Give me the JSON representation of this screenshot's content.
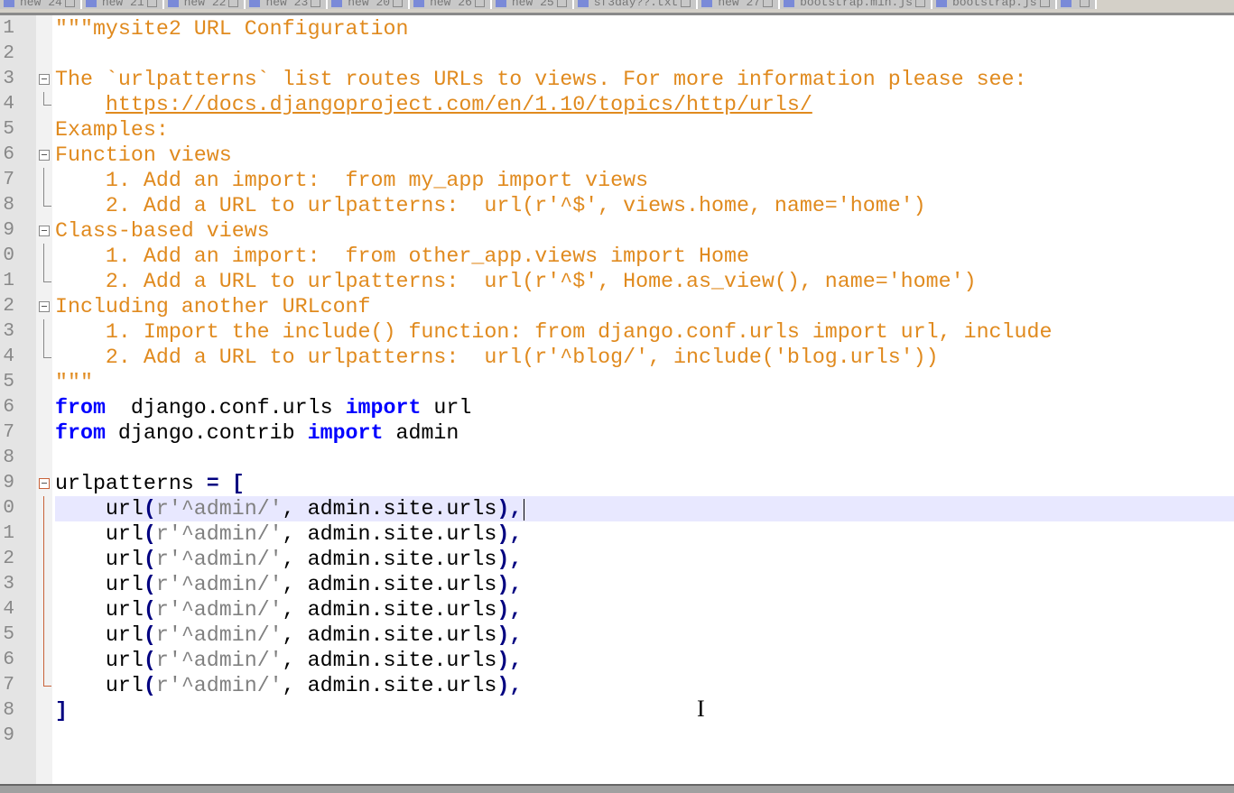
{
  "tabs": [
    "new 24",
    "new 21",
    "new 22",
    "new 23",
    "new 20",
    "new 26",
    "new 25",
    "sf3day??.txt",
    "new 27",
    "bootstrap.min.js",
    "bootstrap.js",
    ""
  ],
  "current_line": 20,
  "lines": [
    {
      "n": "1",
      "t": [
        [
          "doc",
          "\"\"\"mysite2 URL Configuration"
        ]
      ]
    },
    {
      "n": "2",
      "t": []
    },
    {
      "n": "3",
      "f": "box",
      "t": [
        [
          "doc",
          "The `urlpatterns` list routes URLs to views. For more information please see:"
        ]
      ]
    },
    {
      "n": "4",
      "f": "end",
      "t": [
        [
          "doc",
          "    "
        ],
        [
          "link",
          "https://docs.djangoproject.com/en/1.10/topics/http/urls/"
        ]
      ]
    },
    {
      "n": "5",
      "t": [
        [
          "doc",
          "Examples:"
        ]
      ]
    },
    {
      "n": "6",
      "f": "box",
      "t": [
        [
          "doc",
          "Function views"
        ]
      ]
    },
    {
      "n": "7",
      "f": "line",
      "t": [
        [
          "doc",
          "    1. Add an import:  from my_app import views"
        ]
      ]
    },
    {
      "n": "8",
      "f": "end",
      "t": [
        [
          "doc",
          "    2. Add a URL to urlpatterns:  url(r'^$', views.home, name='home')"
        ]
      ]
    },
    {
      "n": "9",
      "f": "box",
      "t": [
        [
          "doc",
          "Class-based views"
        ]
      ]
    },
    {
      "n": "0",
      "f": "line",
      "t": [
        [
          "doc",
          "    1. Add an import:  from other_app.views import Home"
        ]
      ]
    },
    {
      "n": "1",
      "f": "end",
      "t": [
        [
          "doc",
          "    2. Add a URL to urlpatterns:  url(r'^$', Home.as_view(), name='home')"
        ]
      ]
    },
    {
      "n": "2",
      "f": "box",
      "t": [
        [
          "doc",
          "Including another URLconf"
        ]
      ]
    },
    {
      "n": "3",
      "f": "line",
      "t": [
        [
          "doc",
          "    1. Import the include() function: from django.conf.urls import url, include"
        ]
      ]
    },
    {
      "n": "4",
      "f": "end",
      "t": [
        [
          "doc",
          "    2. Add a URL to urlpatterns:  url(r'^blog/', include('blog.urls'))"
        ]
      ]
    },
    {
      "n": "5",
      "t": [
        [
          "doc",
          "\"\"\""
        ]
      ]
    },
    {
      "n": "6",
      "t": [
        [
          "kw",
          "from"
        ],
        [
          "",
          "  django.conf.urls "
        ],
        [
          "kw",
          "import"
        ],
        [
          "",
          " url"
        ]
      ]
    },
    {
      "n": "7",
      "t": [
        [
          "kw",
          "from"
        ],
        [
          "",
          " django.contrib "
        ],
        [
          "kw",
          "import"
        ],
        [
          "",
          " admin"
        ]
      ]
    },
    {
      "n": "8",
      "t": []
    },
    {
      "n": "9",
      "f": "boxred",
      "t": [
        [
          "",
          "urlpatterns "
        ],
        [
          "op",
          "="
        ],
        [
          "",
          " "
        ],
        [
          "op",
          "["
        ]
      ]
    },
    {
      "n": "0",
      "f": "linered",
      "t": [
        [
          "",
          "    url"
        ],
        [
          "op",
          "("
        ],
        [
          "str",
          "r'^admin/'"
        ],
        [
          "",
          ", admin.site.urls"
        ],
        [
          "op",
          "),"
        ]
      ]
    },
    {
      "n": "1",
      "f": "linered",
      "t": [
        [
          "",
          "    url"
        ],
        [
          "op",
          "("
        ],
        [
          "str",
          "r'^admin/'"
        ],
        [
          "",
          ", admin.site.urls"
        ],
        [
          "op",
          "),"
        ]
      ]
    },
    {
      "n": "2",
      "f": "linered",
      "t": [
        [
          "",
          "    url"
        ],
        [
          "op",
          "("
        ],
        [
          "str",
          "r'^admin/'"
        ],
        [
          "",
          ", admin.site.urls"
        ],
        [
          "op",
          "),"
        ]
      ]
    },
    {
      "n": "3",
      "f": "linered",
      "t": [
        [
          "",
          "    url"
        ],
        [
          "op",
          "("
        ],
        [
          "str",
          "r'^admin/'"
        ],
        [
          "",
          ", admin.site.urls"
        ],
        [
          "op",
          "),"
        ]
      ]
    },
    {
      "n": "4",
      "f": "linered",
      "t": [
        [
          "",
          "    url"
        ],
        [
          "op",
          "("
        ],
        [
          "str",
          "r'^admin/'"
        ],
        [
          "",
          ", admin.site.urls"
        ],
        [
          "op",
          "),"
        ]
      ]
    },
    {
      "n": "5",
      "f": "linered",
      "t": [
        [
          "",
          "    url"
        ],
        [
          "op",
          "("
        ],
        [
          "str",
          "r'^admin/'"
        ],
        [
          "",
          ", admin.site.urls"
        ],
        [
          "op",
          "),"
        ]
      ]
    },
    {
      "n": "6",
      "f": "linered",
      "t": [
        [
          "",
          "    url"
        ],
        [
          "op",
          "("
        ],
        [
          "str",
          "r'^admin/'"
        ],
        [
          "",
          ", admin.site.urls"
        ],
        [
          "op",
          "),"
        ]
      ]
    },
    {
      "n": "7",
      "f": "endred",
      "t": [
        [
          "",
          "    url"
        ],
        [
          "op",
          "("
        ],
        [
          "str",
          "r'^admin/'"
        ],
        [
          "",
          ", admin.site.urls"
        ],
        [
          "op",
          "),"
        ]
      ]
    },
    {
      "n": "8",
      "t": [
        [
          "op",
          "]"
        ]
      ]
    },
    {
      "n": "9",
      "t": []
    }
  ],
  "colors": {
    "docstring": "#e08a1e",
    "keyword": "#0000ff",
    "operator": "#000080",
    "string": "#808080",
    "current_line": "#e8e8ff"
  }
}
